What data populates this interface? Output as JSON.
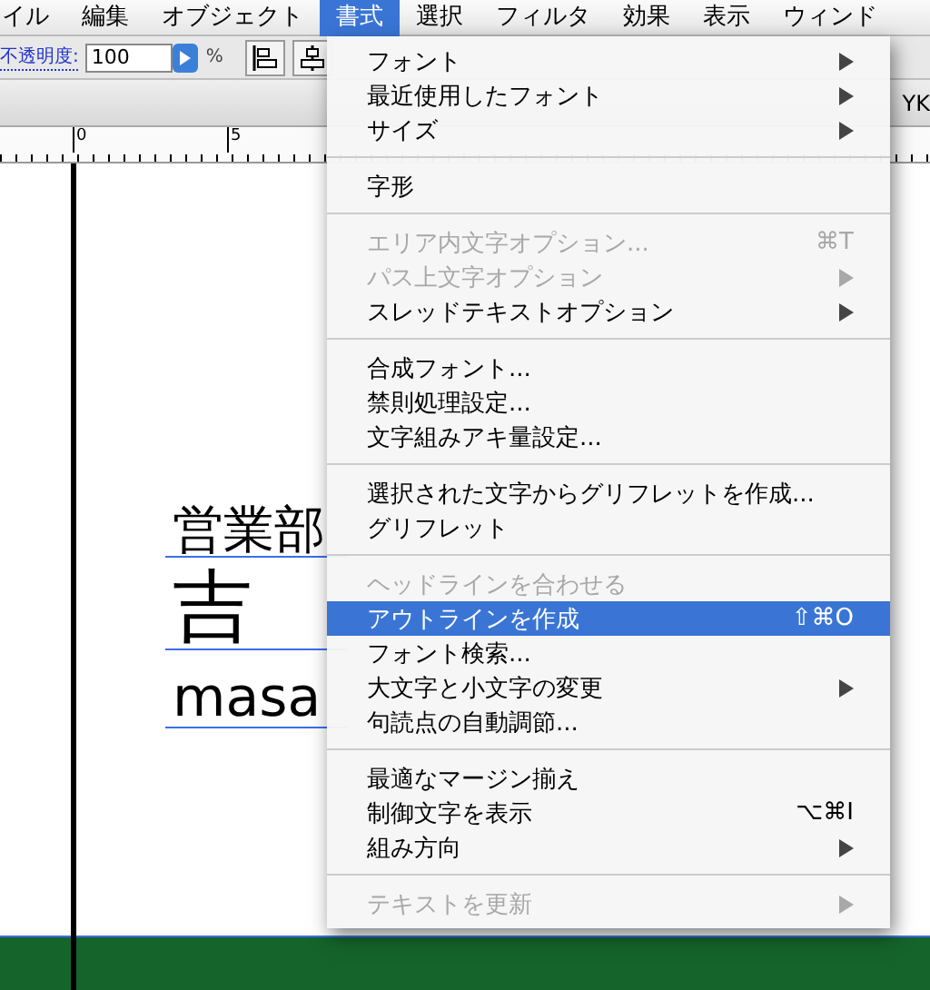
{
  "menubar": [
    {
      "label": "イル",
      "selected": false
    },
    {
      "label": "編集",
      "selected": false
    },
    {
      "label": "オブジェクト",
      "selected": false
    },
    {
      "label": "書式",
      "selected": true
    },
    {
      "label": "選択",
      "selected": false
    },
    {
      "label": "フィルタ",
      "selected": false
    },
    {
      "label": "効果",
      "selected": false
    },
    {
      "label": "表示",
      "selected": false
    },
    {
      "label": "ウィンド",
      "selected": false
    }
  ],
  "toolbar": {
    "opacity_label": "不透明度:",
    "opacity_value": "100",
    "unit": "%"
  },
  "document_title": "YK",
  "ruler": {
    "ticks": [
      "0",
      "5"
    ]
  },
  "canvas": {
    "texts": [
      {
        "text": "営業部",
        "kind": "heading"
      },
      {
        "text": "吉",
        "kind": "large"
      },
      {
        "text": "masa",
        "kind": "latin"
      }
    ]
  },
  "menu": {
    "sections": [
      [
        {
          "label": "フォント",
          "submenu": true,
          "disabled": false,
          "selected": false
        },
        {
          "label": "最近使用したフォント",
          "submenu": true,
          "disabled": false,
          "selected": false
        },
        {
          "label": "サイズ",
          "submenu": true,
          "disabled": false,
          "selected": false
        }
      ],
      [
        {
          "label": "字形",
          "submenu": false,
          "disabled": false,
          "selected": false
        }
      ],
      [
        {
          "label": "エリア内文字オプション...",
          "shortcut": "⌘T",
          "submenu": false,
          "disabled": true,
          "selected": false
        },
        {
          "label": "パス上文字オプション",
          "submenu": true,
          "disabled": true,
          "selected": false
        },
        {
          "label": "スレッドテキストオプション",
          "submenu": true,
          "disabled": false,
          "selected": false
        }
      ],
      [
        {
          "label": "合成フォント...",
          "submenu": false,
          "disabled": false,
          "selected": false
        },
        {
          "label": "禁則処理設定...",
          "submenu": false,
          "disabled": false,
          "selected": false
        },
        {
          "label": "文字組みアキ量設定...",
          "submenu": false,
          "disabled": false,
          "selected": false
        }
      ],
      [
        {
          "label": "選択された文字からグリフレットを作成...",
          "submenu": false,
          "disabled": false,
          "selected": false
        },
        {
          "label": "グリフレット",
          "submenu": false,
          "disabled": false,
          "selected": false
        }
      ],
      [
        {
          "label": "ヘッドラインを合わせる",
          "submenu": false,
          "disabled": true,
          "selected": false
        },
        {
          "label": "アウトラインを作成",
          "shortcut": "⇧⌘O",
          "submenu": false,
          "disabled": false,
          "selected": true
        },
        {
          "label": "フォント検索...",
          "submenu": false,
          "disabled": false,
          "selected": false
        },
        {
          "label": "大文字と小文字の変更",
          "submenu": true,
          "disabled": false,
          "selected": false
        },
        {
          "label": "句読点の自動調節...",
          "submenu": false,
          "disabled": false,
          "selected": false
        }
      ],
      [
        {
          "label": "最適なマージン揃え",
          "submenu": false,
          "disabled": false,
          "selected": false
        },
        {
          "label": "制御文字を表示",
          "shortcut": "⌥⌘I",
          "submenu": false,
          "disabled": false,
          "selected": false
        },
        {
          "label": "組み方向",
          "submenu": true,
          "disabled": false,
          "selected": false
        }
      ],
      [
        {
          "label": "テキストを更新",
          "submenu": true,
          "disabled": true,
          "selected": false
        }
      ]
    ]
  }
}
